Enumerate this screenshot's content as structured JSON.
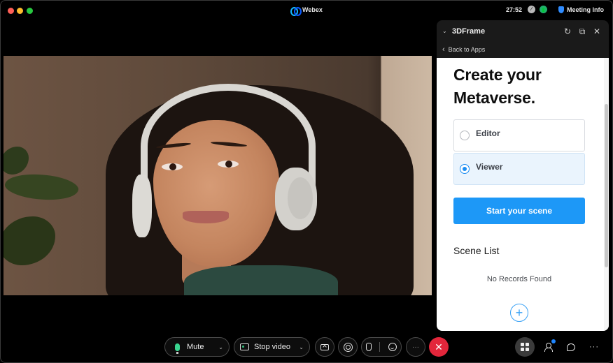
{
  "window": {
    "app_title": "Webex",
    "app_icon": "webex-logo-icon",
    "timer": "27:52",
    "status_icons": [
      "connection-icon",
      "network-stats-icon"
    ],
    "meeting_info_label": "Meeting Info",
    "meeting_info_icon": "shield-icon"
  },
  "panel": {
    "title": "3DFrame",
    "back_label": "Back to Apps",
    "header_actions": [
      {
        "name": "refresh-icon",
        "glyph": "↻"
      },
      {
        "name": "pop-out-icon",
        "glyph": "⧉"
      },
      {
        "name": "close-icon",
        "glyph": "✕"
      }
    ],
    "headline_line1": "Create your",
    "headline_line2": "Metaverse.",
    "options": [
      {
        "label": "Editor",
        "selected": false
      },
      {
        "label": "Viewer",
        "selected": true
      }
    ],
    "start_button_label": "Start your scene",
    "scene_list_title": "Scene List",
    "empty_state": "No Records Found",
    "add_button_glyph": "+",
    "accent_color": "#1d98f7"
  },
  "toolbar": {
    "mute_label": "Mute",
    "stop_video_label": "Stop video",
    "chevron": "⌄",
    "more_glyph": "···",
    "end_glyph": "✕",
    "end_color": "#e3263b",
    "right_more_glyph": "···"
  }
}
